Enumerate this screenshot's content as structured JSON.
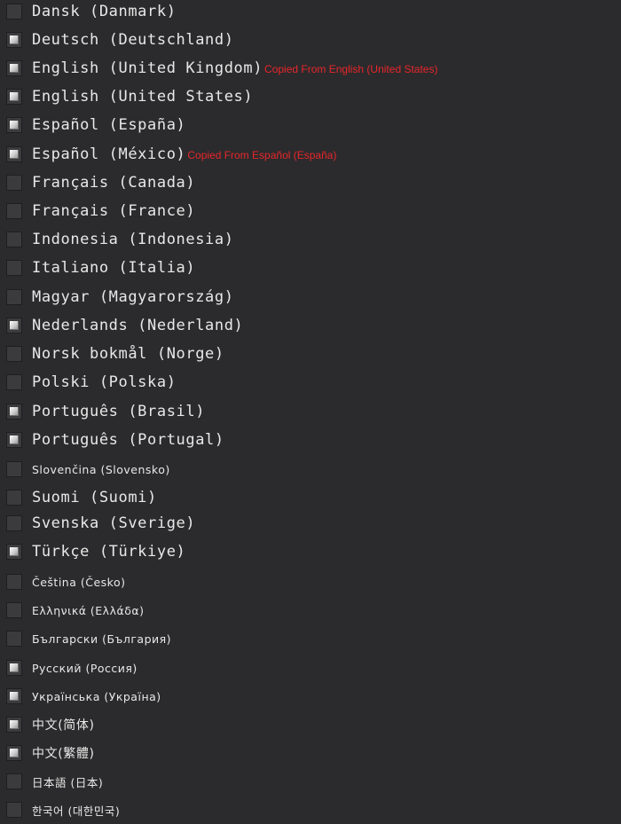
{
  "languages": [
    {
      "label": "Dansk (Danmark)",
      "checked": false,
      "note": ""
    },
    {
      "label": "Deutsch (Deutschland)",
      "checked": true,
      "note": ""
    },
    {
      "label": "English (United Kingdom)",
      "checked": true,
      "note": "Copied From English (United States)"
    },
    {
      "label": "English (United States)",
      "checked": true,
      "note": ""
    },
    {
      "label": "Español (España)",
      "checked": true,
      "note": ""
    },
    {
      "label": "Español (México)",
      "checked": true,
      "note": "Copied From Español (España)"
    },
    {
      "label": "Français (Canada)",
      "checked": false,
      "note": ""
    },
    {
      "label": "Français (France)",
      "checked": false,
      "note": ""
    },
    {
      "label": "Indonesia (Indonesia)",
      "checked": false,
      "note": ""
    },
    {
      "label": "Italiano (Italia)",
      "checked": false,
      "note": ""
    },
    {
      "label": "Magyar (Magyarország)",
      "checked": false,
      "note": ""
    },
    {
      "label": "Nederlands (Nederland)",
      "checked": true,
      "note": ""
    },
    {
      "label": "Norsk bokmål (Norge)",
      "checked": false,
      "note": ""
    },
    {
      "label": "Polski (Polska)",
      "checked": false,
      "note": ""
    },
    {
      "label": "Português (Brasil)",
      "checked": true,
      "note": ""
    },
    {
      "label": "Português (Portugal)",
      "checked": true,
      "note": ""
    },
    {
      "label": "Slovenčina (Slovensko)",
      "checked": false,
      "note": ""
    },
    {
      "label": "Suomi (Suomi)",
      "checked": false,
      "note": ""
    },
    {
      "label": "Svenska (Sverige)",
      "checked": false,
      "note": ""
    },
    {
      "label": "Türkçe (Türkiye)",
      "checked": true,
      "note": ""
    },
    {
      "label": "Čeština (Česko)",
      "checked": false,
      "note": ""
    },
    {
      "label": "Ελληνικά (Ελλάδα)",
      "checked": false,
      "note": ""
    },
    {
      "label": "Български (България)",
      "checked": false,
      "note": ""
    },
    {
      "label": "Русский (Россия)",
      "checked": true,
      "note": ""
    },
    {
      "label": "Українська (Україна)",
      "checked": true,
      "note": ""
    },
    {
      "label": "中文(简体)",
      "checked": true,
      "note": ""
    },
    {
      "label": "中文(繁體)",
      "checked": true,
      "note": ""
    },
    {
      "label": "日本語 (日本)",
      "checked": false,
      "note": ""
    },
    {
      "label": "한국어 (대한민국)",
      "checked": false,
      "note": ""
    }
  ],
  "colors": {
    "background": "#2b2b2d",
    "text": "#e8e8e8",
    "note": "#e8262b",
    "checkbox": "#3b3b3e"
  }
}
